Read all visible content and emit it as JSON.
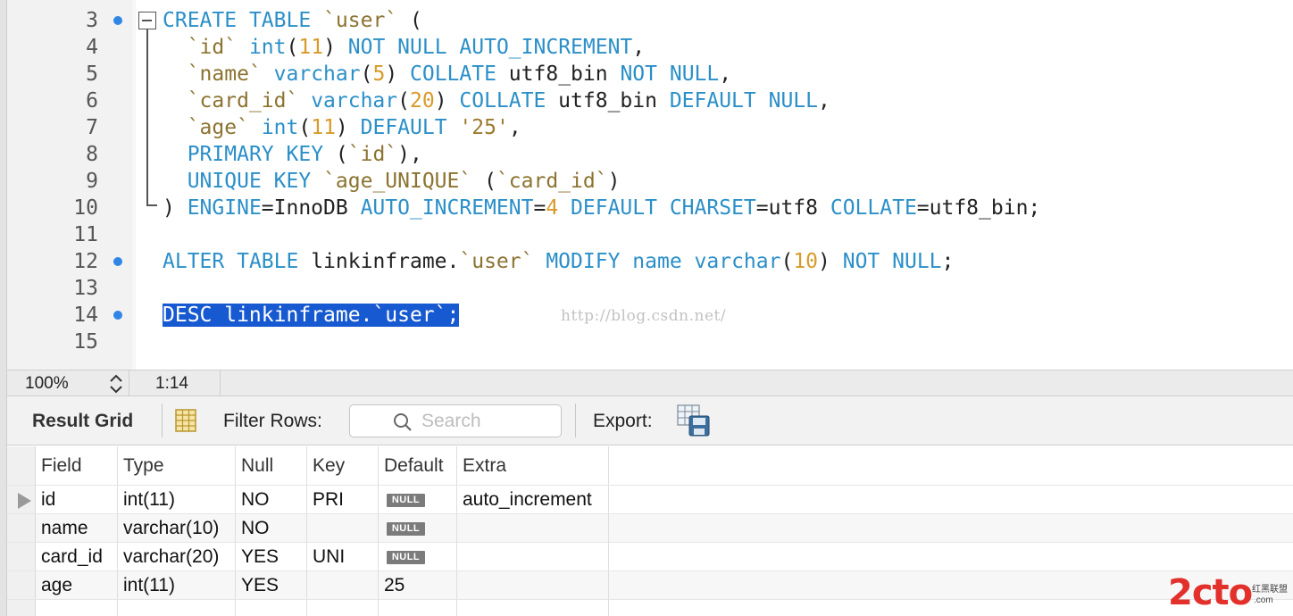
{
  "editor": {
    "lines": [
      {
        "no": "3",
        "marker": true,
        "tokens": [
          {
            "t": "CREATE",
            "c": "kw"
          },
          {
            "t": " "
          },
          {
            "t": "TABLE",
            "c": "kw"
          },
          {
            "t": " "
          },
          {
            "t": "`user`",
            "c": "id"
          },
          {
            "t": " ("
          }
        ]
      },
      {
        "no": "4",
        "marker": false,
        "tokens": [
          {
            "t": "  "
          },
          {
            "t": "`id`",
            "c": "id"
          },
          {
            "t": " "
          },
          {
            "t": "int",
            "c": "kw"
          },
          {
            "t": "("
          },
          {
            "t": "11",
            "c": "num"
          },
          {
            "t": ") "
          },
          {
            "t": "NOT",
            "c": "kw"
          },
          {
            "t": " "
          },
          {
            "t": "NULL",
            "c": "kw"
          },
          {
            "t": " "
          },
          {
            "t": "AUTO_INCREMENT",
            "c": "kw"
          },
          {
            "t": ","
          }
        ]
      },
      {
        "no": "5",
        "marker": false,
        "tokens": [
          {
            "t": "  "
          },
          {
            "t": "`name`",
            "c": "id"
          },
          {
            "t": " "
          },
          {
            "t": "varchar",
            "c": "kw"
          },
          {
            "t": "("
          },
          {
            "t": "5",
            "c": "num"
          },
          {
            "t": ") "
          },
          {
            "t": "COLLATE",
            "c": "kw"
          },
          {
            "t": " utf8_bin "
          },
          {
            "t": "NOT",
            "c": "kw"
          },
          {
            "t": " "
          },
          {
            "t": "NULL",
            "c": "kw"
          },
          {
            "t": ","
          }
        ]
      },
      {
        "no": "6",
        "marker": false,
        "tokens": [
          {
            "t": "  "
          },
          {
            "t": "`card_id`",
            "c": "id"
          },
          {
            "t": " "
          },
          {
            "t": "varchar",
            "c": "kw"
          },
          {
            "t": "("
          },
          {
            "t": "20",
            "c": "num"
          },
          {
            "t": ") "
          },
          {
            "t": "COLLATE",
            "c": "kw"
          },
          {
            "t": " utf8_bin "
          },
          {
            "t": "DEFAULT",
            "c": "kw"
          },
          {
            "t": " "
          },
          {
            "t": "NULL",
            "c": "kw"
          },
          {
            "t": ","
          }
        ]
      },
      {
        "no": "7",
        "marker": false,
        "tokens": [
          {
            "t": "  "
          },
          {
            "t": "`age`",
            "c": "id"
          },
          {
            "t": " "
          },
          {
            "t": "int",
            "c": "kw"
          },
          {
            "t": "("
          },
          {
            "t": "11",
            "c": "num"
          },
          {
            "t": ") "
          },
          {
            "t": "DEFAULT",
            "c": "kw"
          },
          {
            "t": " "
          },
          {
            "t": "'25'",
            "c": "str"
          },
          {
            "t": ","
          }
        ]
      },
      {
        "no": "8",
        "marker": false,
        "tokens": [
          {
            "t": "  "
          },
          {
            "t": "PRIMARY",
            "c": "kw"
          },
          {
            "t": " "
          },
          {
            "t": "KEY",
            "c": "kw"
          },
          {
            "t": " ("
          },
          {
            "t": "`id`",
            "c": "id"
          },
          {
            "t": "),"
          }
        ]
      },
      {
        "no": "9",
        "marker": false,
        "tokens": [
          {
            "t": "  "
          },
          {
            "t": "UNIQUE",
            "c": "kw"
          },
          {
            "t": " "
          },
          {
            "t": "KEY",
            "c": "kw"
          },
          {
            "t": " "
          },
          {
            "t": "`age_UNIQUE`",
            "c": "id"
          },
          {
            "t": " ("
          },
          {
            "t": "`card_id`",
            "c": "id"
          },
          {
            "t": ")"
          }
        ]
      },
      {
        "no": "10",
        "marker": false,
        "tokens": [
          {
            "t": ") "
          },
          {
            "t": "ENGINE",
            "c": "kw"
          },
          {
            "t": "=InnoDB "
          },
          {
            "t": "AUTO_INCREMENT",
            "c": "kw"
          },
          {
            "t": "="
          },
          {
            "t": "4",
            "c": "num"
          },
          {
            "t": " "
          },
          {
            "t": "DEFAULT",
            "c": "kw"
          },
          {
            "t": " "
          },
          {
            "t": "CHARSET",
            "c": "kw"
          },
          {
            "t": "=utf8 "
          },
          {
            "t": "COLLATE",
            "c": "kw"
          },
          {
            "t": "=utf8_bin;"
          }
        ]
      },
      {
        "no": "11",
        "marker": false,
        "tokens": []
      },
      {
        "no": "12",
        "marker": true,
        "tokens": [
          {
            "t": "ALTER",
            "c": "kw"
          },
          {
            "t": " "
          },
          {
            "t": "TABLE",
            "c": "kw"
          },
          {
            "t": " linkinframe."
          },
          {
            "t": "`user`",
            "c": "id"
          },
          {
            "t": " "
          },
          {
            "t": "MODIFY",
            "c": "kw"
          },
          {
            "t": " "
          },
          {
            "t": "name",
            "c": "kw"
          },
          {
            "t": " "
          },
          {
            "t": "varchar",
            "c": "kw"
          },
          {
            "t": "("
          },
          {
            "t": "10",
            "c": "num"
          },
          {
            "t": ") "
          },
          {
            "t": "NOT",
            "c": "kw"
          },
          {
            "t": " "
          },
          {
            "t": "NULL",
            "c": "kw"
          },
          {
            "t": ";"
          }
        ]
      },
      {
        "no": "13",
        "marker": false,
        "tokens": []
      },
      {
        "no": "14",
        "marker": true,
        "tokens": [
          {
            "t": "DESC linkinframe.`user`;",
            "c": "sel"
          }
        ]
      },
      {
        "no": "15",
        "marker": false,
        "tokens": []
      }
    ],
    "watermark": "http://blog.csdn.net/"
  },
  "status_bar": {
    "zoom": "100%",
    "cursor_position": "1:14"
  },
  "result_toolbar": {
    "title": "Result Grid",
    "filter_label": "Filter Rows:",
    "search_placeholder": "Search",
    "search_value": "",
    "export_label": "Export:",
    "icons": [
      "grid-view-icon",
      "search-icon",
      "export-icon"
    ]
  },
  "result_grid": {
    "columns": [
      "Field",
      "Type",
      "Null",
      "Key",
      "Default",
      "Extra"
    ],
    "rows": [
      [
        "id",
        "int(11)",
        "NO",
        "PRI",
        "NULL",
        "auto_increment"
      ],
      [
        "name",
        "varchar(10)",
        "NO",
        "",
        "NULL",
        ""
      ],
      [
        "card_id",
        "varchar(20)",
        "YES",
        "UNI",
        "NULL",
        ""
      ],
      [
        "age",
        "int(11)",
        "YES",
        "",
        "25",
        ""
      ]
    ],
    "current_row": 0
  },
  "logo": {
    "text": "2cto",
    "cn": "红黑联盟",
    "com": ".com"
  },
  "colors": {
    "keyword": "#2b8fc8",
    "number": "#d99a2a",
    "identifier": "#8b7330",
    "selection": "#1759d0",
    "marker": "#2f86e5",
    "logo": "#e2312b"
  }
}
